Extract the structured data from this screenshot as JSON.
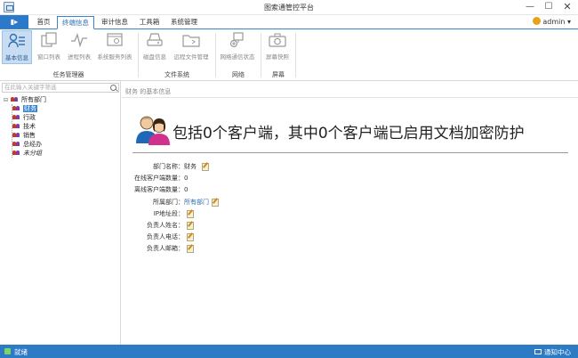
{
  "window": {
    "title": "图索通管控平台",
    "min": "—",
    "max": "☐",
    "close": "✕"
  },
  "menu": {
    "button": "▮▸",
    "tabs": [
      {
        "label": "首页"
      },
      {
        "label": "终端信息"
      },
      {
        "label": "审计信息"
      },
      {
        "label": "工具箱"
      },
      {
        "label": "系统管理"
      }
    ],
    "user": "admin",
    "user_caret": "▾"
  },
  "ribbon": {
    "buttons": [
      {
        "label": "基本信息",
        "icon": "basic-info-icon"
      },
      {
        "label": "窗口列表",
        "icon": "window-list-icon"
      },
      {
        "label": "进程列表",
        "icon": "process-list-icon"
      },
      {
        "label": "系统服务列表",
        "icon": "service-list-icon"
      },
      {
        "label": "磁盘信息",
        "icon": "disk-icon"
      },
      {
        "label": "远程文件管理",
        "icon": "folder-icon"
      },
      {
        "label": "网络通信状态",
        "icon": "network-icon"
      },
      {
        "label": "屏幕快照",
        "icon": "camera-icon"
      }
    ],
    "groups": [
      {
        "label": "任务管理器"
      },
      {
        "label": "文件系统"
      },
      {
        "label": "网络"
      },
      {
        "label": "屏幕"
      }
    ]
  },
  "left": {
    "search_placeholder": "在此输入关键字筛选",
    "tree": {
      "root": "所有部门",
      "toggle": "⊟",
      "children": [
        {
          "label": "财务"
        },
        {
          "label": "行政"
        },
        {
          "label": "技术"
        },
        {
          "label": "销售"
        },
        {
          "label": "总经办"
        },
        {
          "label": "未分组"
        }
      ]
    }
  },
  "right": {
    "breadcrumb": "财务 的基本信息",
    "headline": "包括0个客户端，其中0个客户端已启用文档加密防护",
    "fields": [
      {
        "key": "部门名称：",
        "value": "财务",
        "edit": true
      },
      {
        "key": "在线客户端数量：",
        "value": "0",
        "edit": false
      },
      {
        "key": "离线客户端数量：",
        "value": "0",
        "edit": false
      },
      {
        "key": "所属部门：",
        "value": "所有部门",
        "edit": true,
        "link": true
      },
      {
        "key": "IP地址段：",
        "value": "",
        "edit": true
      },
      {
        "key": "负责人姓名：",
        "value": "",
        "edit": true
      },
      {
        "key": "负责人电话：",
        "value": "",
        "edit": true
      },
      {
        "key": "负责人邮箱：",
        "value": "",
        "edit": true
      }
    ]
  },
  "status": {
    "text": "就绪",
    "notify": "通知中心"
  },
  "colors": {
    "accent": "#2c7bc4",
    "selected": "#3a84c9"
  }
}
